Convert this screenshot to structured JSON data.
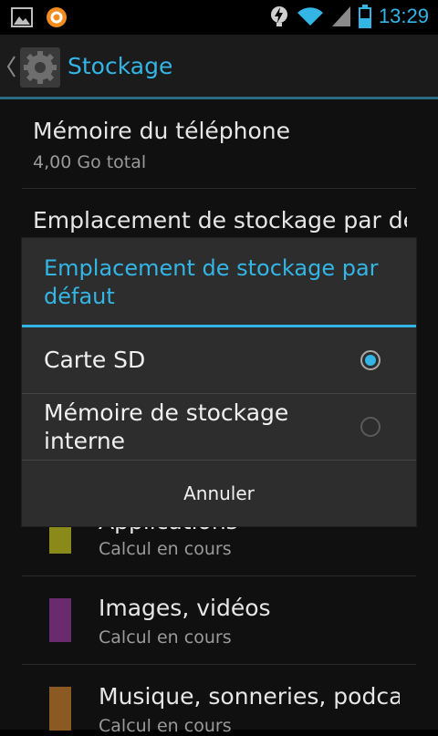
{
  "status_bar": {
    "time": "13:29",
    "icons": [
      "gallery-icon",
      "sync-app-icon",
      "power-saver-icon",
      "wifi-icon",
      "signal-icon",
      "battery-icon"
    ]
  },
  "action_bar": {
    "title": "Stockage",
    "icon": "settings-gear-icon"
  },
  "storage_list": {
    "phone_memory_title": "Mémoire du téléphone",
    "phone_memory_total": "4,00  Go total",
    "default_location_title": "Emplacement de stockage par défaut",
    "categories": [
      {
        "title": "Applications",
        "subtitle": "Calcul en cours",
        "color": "#8a8a1a"
      },
      {
        "title": "Images, vidéos",
        "subtitle": "Calcul en cours",
        "color": "#6a2a6e"
      },
      {
        "title": "Musique, sonneries, podcasts",
        "subtitle": "Calcul en cours",
        "color": "#8a5a22"
      }
    ]
  },
  "dialog": {
    "title": "Emplacement de stockage par défaut",
    "options": [
      {
        "label": "Carte SD",
        "selected": true
      },
      {
        "label": "Mémoire de stockage interne",
        "selected": false
      }
    ],
    "cancel_label": "Annuler"
  },
  "colors": {
    "accent": "#33b5e5",
    "background": "#101010",
    "dialog": "#2d2d2d"
  }
}
